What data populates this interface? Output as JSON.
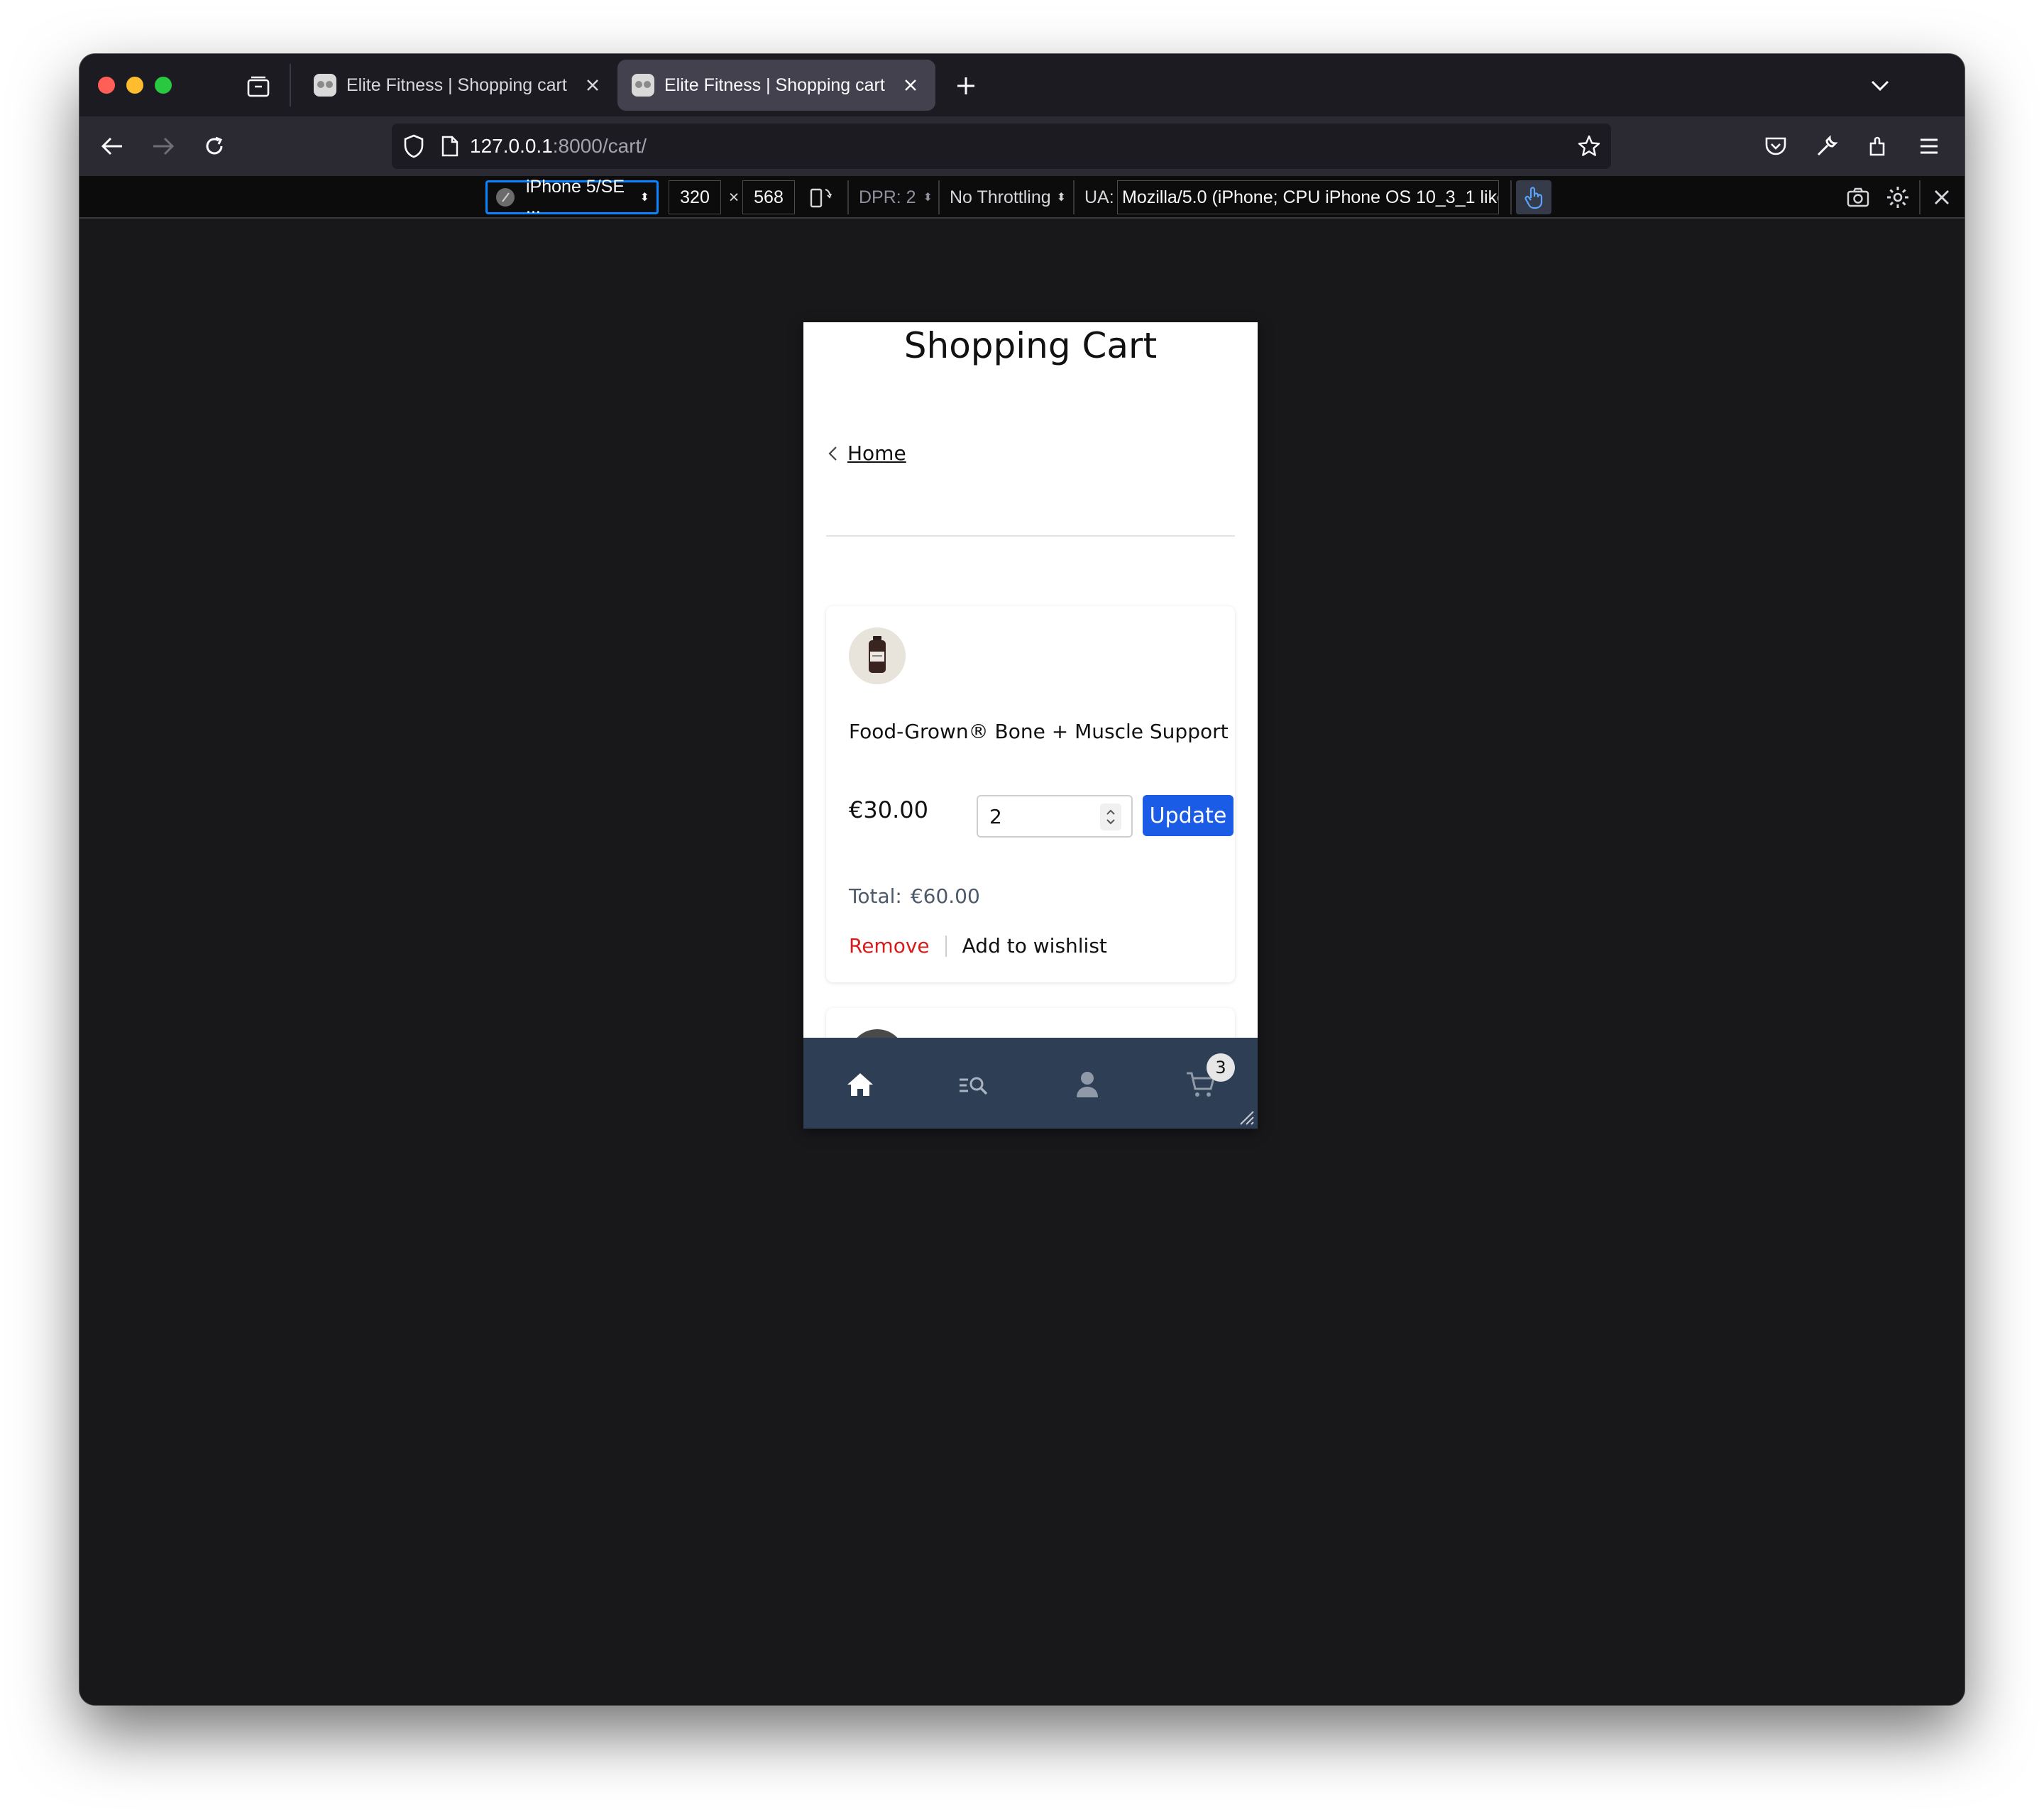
{
  "browser": {
    "tabs": [
      {
        "title": "Elite Fitness | Shopping cart",
        "active": false
      },
      {
        "title": "Elite Fitness | Shopping cart",
        "active": true
      }
    ],
    "url_host": "127.0.0.1",
    "url_rest": ":8000/cart/"
  },
  "rdm": {
    "device": "iPhone 5/SE ...",
    "width": "320",
    "height": "568",
    "times": "×",
    "dpr": "DPR: 2",
    "throttling": "No Throttling",
    "ua_label": "UA:",
    "ua_value": "Mozilla/5.0 (iPhone; CPU iPhone OS 10_3_1 like"
  },
  "page": {
    "title": "Shopping Cart",
    "back_label": "Home",
    "items": [
      {
        "name": "Food-Grown® Bone + Muscle Support",
        "price": "€30.00",
        "quantity": "2",
        "update_label": "Update",
        "total_label": "Total:",
        "total_value": "€60.00",
        "remove_label": "Remove",
        "wishlist_label": "Add to wishlist"
      }
    ],
    "cart_count": "3"
  },
  "colors": {
    "update_button": "#1a5ce5",
    "remove_link": "#d81b1b",
    "bottom_nav": "#2d3e55",
    "focus_ring": "#0a84ff"
  },
  "icons": [
    "home-icon",
    "search-list-icon",
    "user-icon",
    "cart-icon"
  ]
}
